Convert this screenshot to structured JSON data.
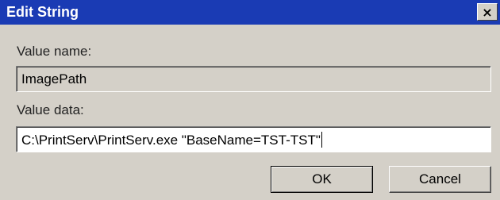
{
  "window": {
    "title": "Edit String",
    "close_glyph": "×"
  },
  "value_name": {
    "label": "Value name:",
    "value": "ImagePath"
  },
  "value_data": {
    "label": "Value data:",
    "value": "C:\\PrintServ\\PrintServ.exe \"BaseName=TST-TST\""
  },
  "buttons": {
    "ok_label": "OK",
    "cancel_label": "Cancel"
  },
  "colors": {
    "title_bar": "#1a3bb4",
    "dialog_face": "#d4d0c8"
  }
}
